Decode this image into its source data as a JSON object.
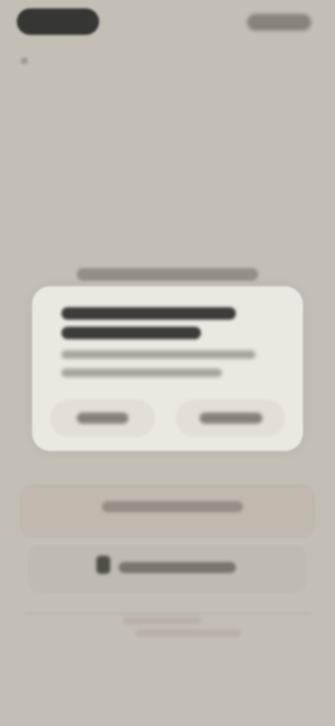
{
  "statusbar": {
    "time": "",
    "icons": [
      "status-icons"
    ]
  },
  "dialog": {
    "label": "",
    "title": "",
    "body": "",
    "buttons": [
      {
        "label": ""
      },
      {
        "label": ""
      }
    ]
  },
  "background": {
    "primary_button_label": "",
    "secondary_button_label": "",
    "footer_text": ""
  },
  "icons": {
    "secondary_button_icon": "apple-icon"
  }
}
